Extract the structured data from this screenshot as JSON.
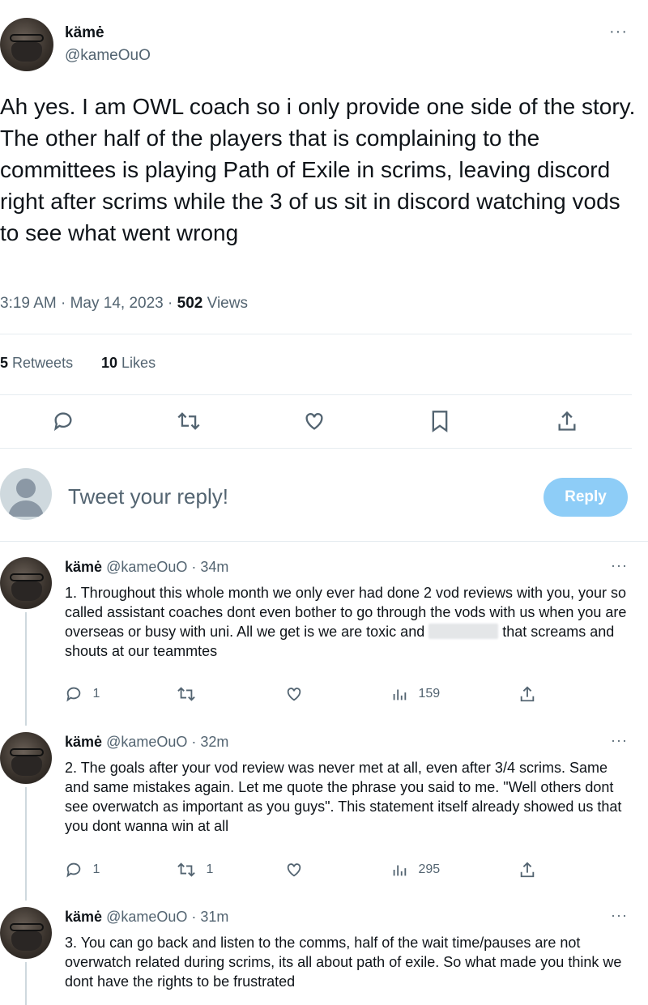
{
  "main_tweet": {
    "display_name": "kämė",
    "handle": "@kameOuO",
    "more": "···",
    "text": "Ah yes. I am OWL coach so i only provide one side of the story. The other half of the players that is complaining to the committees is playing Path of Exile in scrims, leaving discord right after scrims while the 3 of us sit in discord watching vods to see what went wrong",
    "time": "3:19 AM",
    "sep": "·",
    "date": "May 14, 2023",
    "views_count": "502",
    "views_label": "Views",
    "retweets_count": "5",
    "retweets_label": "Retweets",
    "likes_count": "10",
    "likes_label": "Likes"
  },
  "composer": {
    "placeholder": "Tweet your reply!",
    "reply_label": "Reply"
  },
  "replies": [
    {
      "display_name": "kämė",
      "handle": "@kameOuO",
      "time": "· 34m",
      "more": "···",
      "text_before": "1. Throughout this whole month we only ever had done 2 vod reviews with you, your so called assistant coaches dont even bother to go through the vods with us when you are overseas or busy with uni. All we get is we are toxic and",
      "text_after": "that screams and shouts at our teammtes",
      "reply_count": "1",
      "retweet_count": "",
      "views": "159"
    },
    {
      "display_name": "kämė",
      "handle": "@kameOuO",
      "time": "· 32m",
      "more": "···",
      "text": "2. The goals after your vod review was never met at all, even after 3/4 scrims. Same and same mistakes again. Let me quote the phrase you said to me. \"Well others dont see overwatch as important as you guys\". This statement itself already showed us that you dont wanna win at all",
      "reply_count": "1",
      "retweet_count": "1",
      "views": "295"
    },
    {
      "display_name": "kämė",
      "handle": "@kameOuO",
      "time": "· 31m",
      "more": "···",
      "text": "3. You can go back and listen to the comms, half of the wait time/pauses are not overwatch related during scrims, its all about path of exile. So what made you think we dont have the rights to be frustrated"
    }
  ],
  "colors": {
    "accent": "#1d9bf0",
    "reply_button_disabled": "#8ecdf7",
    "muted": "#536471",
    "text": "#0f1419",
    "divider": "#e6ecf0"
  }
}
